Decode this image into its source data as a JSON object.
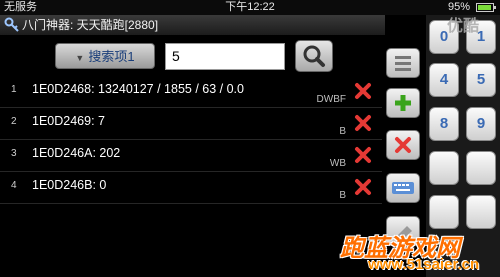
{
  "status_bar": {
    "carrier": "无服务",
    "time": "下午12:22",
    "battery": "95%",
    "battery_level": 0.95
  },
  "title_bar": {
    "title": "八门神器: 天天酷跑[2880]"
  },
  "search": {
    "button_label": "搜索项1",
    "value": "5"
  },
  "results": [
    {
      "index": "1",
      "text": "1E0D2468: 13240127 / 1855 / 63 / 0.0",
      "type": "DWBF"
    },
    {
      "index": "2",
      "text": "1E0D2469: 7",
      "type": "B"
    },
    {
      "index": "3",
      "text": "1E0D246A: 202",
      "type": "WB"
    },
    {
      "index": "4",
      "text": "1E0D246B: 0",
      "type": "B"
    }
  ],
  "sidebar": {
    "icons": [
      "list-icon",
      "add-icon",
      "remove-icon",
      "keyboard-icon",
      "clear-icon"
    ]
  },
  "keypad": {
    "keys": [
      "0",
      "1",
      "4",
      "5",
      "8",
      "9",
      "",
      ""
    ]
  },
  "watermarks": {
    "top": "优酷",
    "bottom_logo": "跑蓝游戏网",
    "bottom_url": "www.51saier.cn"
  },
  "colors": {
    "delete": "#e53935",
    "add": "#3aa41b",
    "keypad_text": "#3a6ab4",
    "title_blue": "#1a3e7a"
  }
}
